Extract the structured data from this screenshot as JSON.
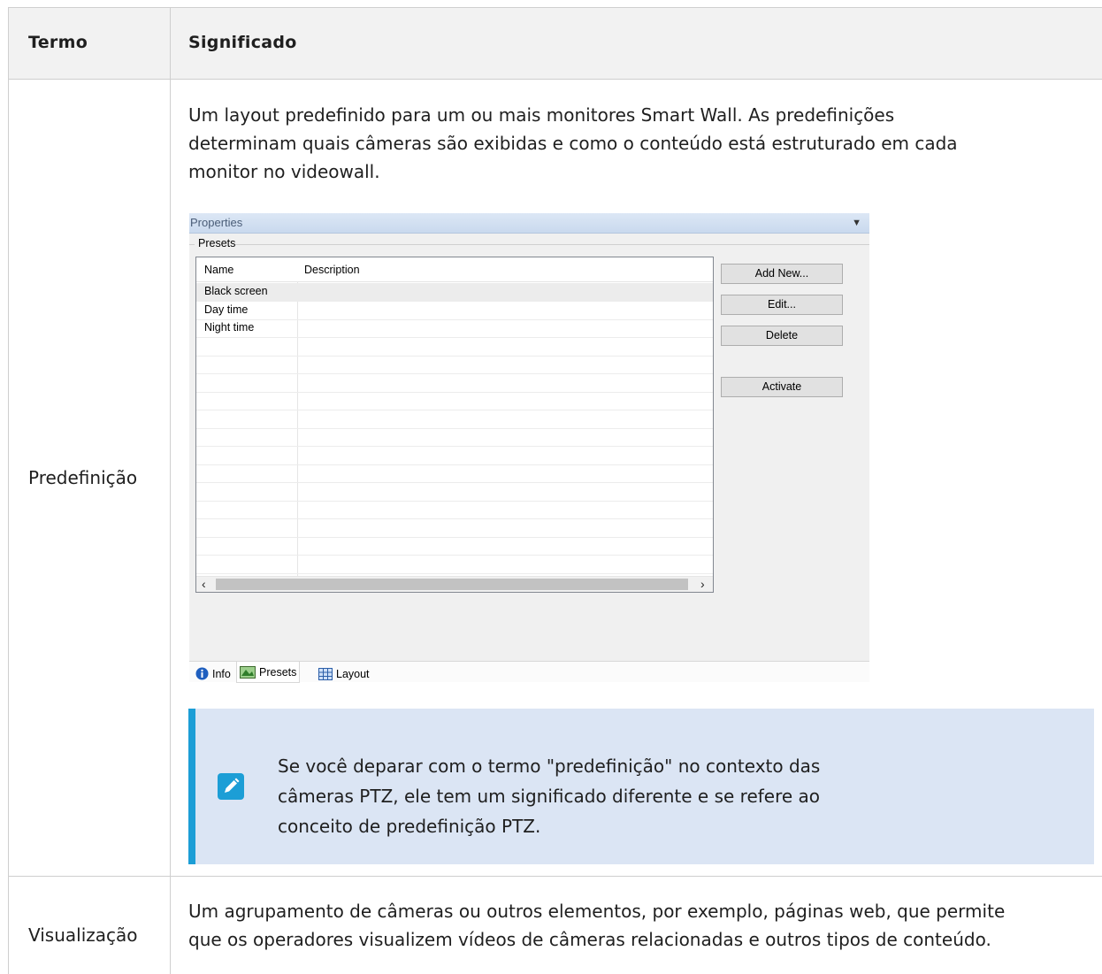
{
  "table": {
    "headers": {
      "term": "Termo",
      "meaning": "Significado"
    },
    "rows": [
      {
        "term": "Predefinição",
        "meaning_lines": [
          "Um layout predefinido para um ou mais monitores Smart Wall. As predefinições",
          "determinam quais câmeras são exibidas e como o conteúdo está estruturado em cada",
          "monitor no videowall."
        ],
        "note_lines": [
          "Se você deparar com o termo \"predefinição\" no contexto das",
          "câmeras PTZ, ele tem um significado diferente e se refere ao",
          "conceito de predefinição PTZ."
        ]
      },
      {
        "term": "Visualização",
        "meaning_lines": [
          "Um agrupamento de câmeras ou outros elementos, por exemplo, páginas web, que permite",
          "que os operadores visualizem vídeos de câmeras relacionadas e outros tipos de conteúdo."
        ]
      }
    ]
  },
  "screenshot": {
    "title": "Properties",
    "group": "Presets",
    "columns": [
      "Name",
      "Description"
    ],
    "presets": [
      {
        "name": "Black screen",
        "selected": true
      },
      {
        "name": "Day time",
        "selected": false
      },
      {
        "name": "Night time",
        "selected": false
      }
    ],
    "buttons": [
      "Add New...",
      "Edit...",
      "Delete",
      "Activate"
    ],
    "tabs": [
      "Info",
      "Presets",
      "Layout"
    ],
    "active_tab": "Presets"
  },
  "colors": {
    "note_background": "#dbe5f4",
    "note_accent": "#1c9ed6",
    "header_background": "#f2f2f2"
  }
}
